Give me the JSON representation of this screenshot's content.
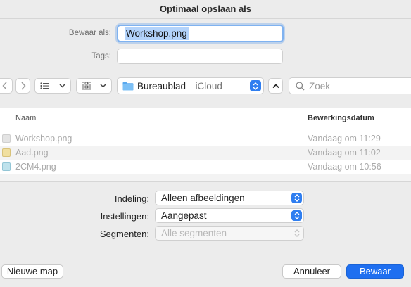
{
  "dialog": {
    "title": "Optimaal opslaan als"
  },
  "save_as": {
    "label": "Bewaar als:",
    "value": "Workshop.png"
  },
  "tags": {
    "label": "Tags:",
    "value": ""
  },
  "toolbar": {
    "location": {
      "name": "Bureaublad",
      "separator": " — ",
      "service": "iCloud"
    },
    "search_placeholder": "Zoek"
  },
  "file_list": {
    "columns": {
      "name": "Naam",
      "date": "Bewerkingsdatum"
    },
    "rows": [
      {
        "name": "Workshop.png",
        "date": "Vandaag om 11:29",
        "icon": "image-file-icon"
      },
      {
        "name": "Aad.png",
        "date": "Vandaag om 11:02",
        "icon": "image-file-icon"
      },
      {
        "name": "2CM4.png",
        "date": "Vandaag om 10:56",
        "icon": "image-file-icon"
      }
    ]
  },
  "options": {
    "format": {
      "label": "Indeling:",
      "value": "Alleen afbeeldingen"
    },
    "settings": {
      "label": "Instellingen:",
      "value": "Aangepast"
    },
    "segments": {
      "label": "Segmenten:",
      "value": "Alle segmenten"
    }
  },
  "buttons": {
    "new_folder": "Nieuwe map",
    "cancel": "Annuleer",
    "save": "Bewaar"
  },
  "colors": {
    "accent": "#1f6ff0",
    "selection": "#b3d3fb",
    "focus_ring": "#7fb2f0"
  }
}
